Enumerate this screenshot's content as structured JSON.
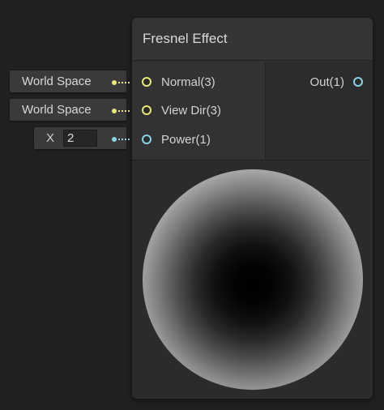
{
  "node": {
    "title": "Fresnel Effect",
    "inputs": [
      {
        "label": "Normal(3)",
        "color": "#e8e87a"
      },
      {
        "label": "View Dir(3)",
        "color": "#e8e87a"
      },
      {
        "label": "Power(1)",
        "color": "#87d5e4"
      }
    ],
    "outputs": [
      {
        "label": "Out(1)",
        "color": "#87d5e4"
      }
    ]
  },
  "external_inputs": {
    "normal_space": "World Space",
    "view_dir_space": "World Space",
    "power_axis_label": "X",
    "power_value": "2"
  },
  "colors": {
    "background": "#202020",
    "node_body": "#2f2f2f",
    "vector3_port": "#e8e87a",
    "vector1_port": "#87d5e4"
  }
}
